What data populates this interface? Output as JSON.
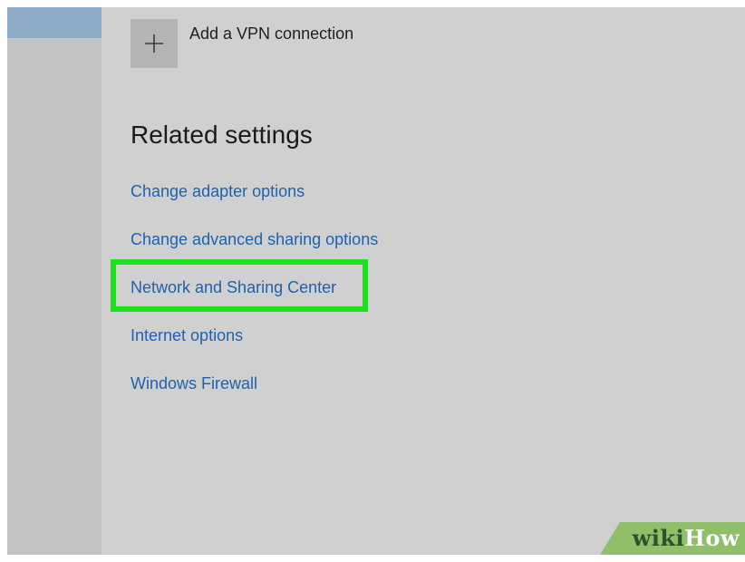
{
  "vpn": {
    "add_label": "Add a VPN connection",
    "add_icon": "plus-icon"
  },
  "related_settings": {
    "title": "Related settings",
    "links": [
      {
        "label": "Change adapter options"
      },
      {
        "label": "Change advanced sharing options"
      },
      {
        "label": "Network and Sharing Center",
        "highlighted": true
      },
      {
        "label": "Internet options"
      },
      {
        "label": "Windows Firewall"
      }
    ]
  },
  "watermark": {
    "part1": "wiki",
    "part2": "How"
  },
  "colors": {
    "link": "#1d62b0",
    "highlight": "#1ee21e",
    "background": "#d0d0d0",
    "sidebar_selected": "#8dabc6",
    "watermark_bg": "#8fbf69"
  }
}
